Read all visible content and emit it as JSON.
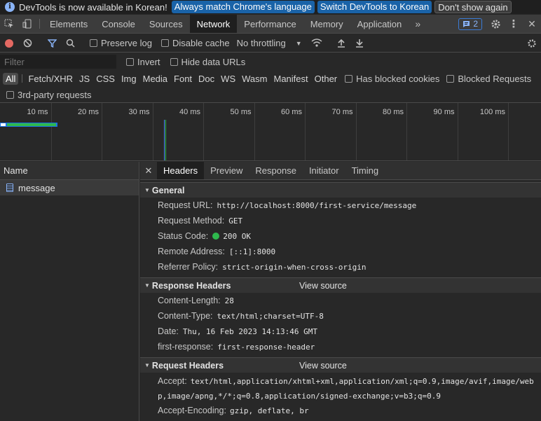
{
  "infobar": {
    "message": "DevTools is now available in Korean!",
    "btn_match": "Always match Chrome's language",
    "btn_switch": "Switch DevTools to Korean",
    "btn_dismiss": "Don't show again"
  },
  "tabs": [
    "Elements",
    "Console",
    "Sources",
    "Network",
    "Performance",
    "Memory",
    "Application"
  ],
  "active_tab": "Network",
  "issues_count": "2",
  "toolbar": {
    "preserve_log": "Preserve log",
    "disable_cache": "Disable cache",
    "throttling": "No throttling"
  },
  "filter": {
    "placeholder": "Filter",
    "invert": "Invert",
    "hide_data_urls": "Hide data URLs"
  },
  "type_filters": [
    "All",
    "Fetch/XHR",
    "JS",
    "CSS",
    "Img",
    "Media",
    "Font",
    "Doc",
    "WS",
    "Wasm",
    "Manifest",
    "Other"
  ],
  "has_blocked_cookies": "Has blocked cookies",
  "blocked_requests": "Blocked Requests",
  "third_party": "3rd-party requests",
  "timeline_ticks": [
    "10 ms",
    "20 ms",
    "30 ms",
    "40 ms",
    "50 ms",
    "60 ms",
    "70 ms",
    "80 ms",
    "90 ms",
    "100 ms",
    "11"
  ],
  "name_header": "Name",
  "request_name": "message",
  "detail_tabs": [
    "Headers",
    "Preview",
    "Response",
    "Initiator",
    "Timing"
  ],
  "general": {
    "title": "General",
    "rows": [
      {
        "k": "Request URL:",
        "v": "http://localhost:8000/first-service/message"
      },
      {
        "k": "Request Method:",
        "v": "GET"
      },
      {
        "k": "Status Code:",
        "v": "200 OK"
      },
      {
        "k": "Remote Address:",
        "v": "[::1]:8000"
      },
      {
        "k": "Referrer Policy:",
        "v": "strict-origin-when-cross-origin"
      }
    ]
  },
  "response_headers": {
    "title": "Response Headers",
    "view_source": "View source",
    "rows": [
      {
        "k": "Content-Length:",
        "v": "28"
      },
      {
        "k": "Content-Type:",
        "v": "text/html;charset=UTF-8"
      },
      {
        "k": "Date:",
        "v": "Thu, 16 Feb 2023 14:13:46 GMT"
      },
      {
        "k": "first-response:",
        "v": "first-response-header"
      }
    ]
  },
  "request_headers": {
    "title": "Request Headers",
    "view_source": "View source",
    "accept_k": "Accept:",
    "accept_v": "text/html,application/xhtml+xml,application/xml;q=0.9,image/avif,image/webp,image/apng,*/*;q=0.8,application/signed-exchange;v=b3;q=0.9",
    "accept_encoding_k": "Accept-Encoding:",
    "accept_encoding_v": "gzip, deflate, br"
  }
}
